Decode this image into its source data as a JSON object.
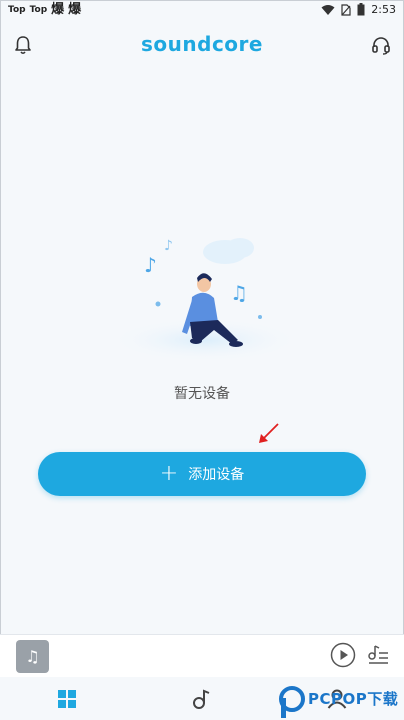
{
  "status_bar": {
    "app_label_1": "Top",
    "app_label_2": "Top",
    "icon_glyph_1": "爆",
    "icon_glyph_2": "爆",
    "time": "2:53"
  },
  "header": {
    "logo": "soundcore",
    "left_icon": "bell-icon",
    "right_icon": "headset-icon"
  },
  "main": {
    "empty_text": "暂无设备",
    "add_button_label": "添加设备",
    "add_button_icon": "+"
  },
  "mini_player": {
    "album_icon": "♫"
  },
  "bottom_nav": {
    "items": [
      "grid-icon",
      "music-note-icon",
      "profile-icon"
    ]
  },
  "watermark": {
    "text": "PCPOP下载"
  },
  "colors": {
    "accent": "#1ea8e0",
    "background": "#f5f8fb",
    "arrow": "#e02020"
  }
}
